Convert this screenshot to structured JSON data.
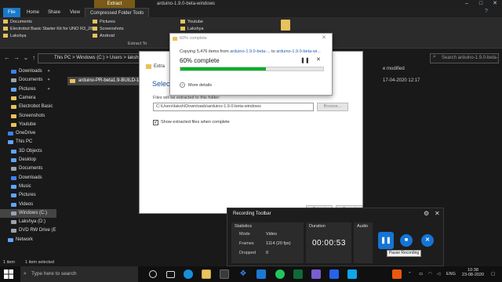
{
  "window": {
    "context_tab": "Extract",
    "title": "arduino-1.9.0-beta-windows"
  },
  "ribbon": {
    "tabs": [
      "File",
      "Home",
      "Share",
      "View",
      "Compressed Folder Tools"
    ],
    "quick_col1": [
      "Documents",
      "Electrobot Basic Starter Kit for UNO R3_28",
      "Lakshya"
    ],
    "quick_col2": [
      "Pictures",
      "Screenshots",
      "Android"
    ],
    "quick_col3": [
      "Youtube",
      "Lakshya"
    ],
    "group_label": "Extract To"
  },
  "address": {
    "crumbs": [
      "This PC",
      "Windows (C:)",
      "Users",
      "laksh"
    ],
    "search_placeholder": "Search arduino-1.9.0-beta-w..."
  },
  "nav": {
    "items": [
      {
        "label": "Downloads",
        "icon": "download-icon",
        "color": "#3b82f6",
        "pinned": true
      },
      {
        "label": "Documents",
        "icon": "document-icon",
        "color": "#9ca3af",
        "pinned": true
      },
      {
        "label": "Pictures",
        "icon": "picture-icon",
        "color": "#60a5fa",
        "pinned": true
      },
      {
        "label": "Camera",
        "icon": "folder-icon",
        "color": "#e8c25b",
        "pinned": false
      },
      {
        "label": "Electrobot Basic",
        "icon": "folder-icon",
        "color": "#e8c25b",
        "pinned": false
      },
      {
        "label": "Screenshots",
        "icon": "folder-icon",
        "color": "#e8c25b",
        "pinned": false
      },
      {
        "label": "Youtube",
        "icon": "folder-icon",
        "color": "#e8c25b",
        "pinned": false
      },
      {
        "label": "OneDrive",
        "icon": "cloud-icon",
        "color": "#3b82f6",
        "pinned": false
      },
      {
        "label": "This PC",
        "icon": "computer-icon",
        "color": "#60a5fa",
        "pinned": false
      },
      {
        "label": "3D Objects",
        "icon": "cube-icon",
        "color": "#60a5fa",
        "pinned": false
      },
      {
        "label": "Desktop",
        "icon": "desktop-icon",
        "color": "#60a5fa",
        "pinned": false
      },
      {
        "label": "Documents",
        "icon": "document-icon",
        "color": "#9ca3af",
        "pinned": false
      },
      {
        "label": "Downloads",
        "icon": "download-icon",
        "color": "#3b82f6",
        "pinned": false
      },
      {
        "label": "Music",
        "icon": "music-icon",
        "color": "#60a5fa",
        "pinned": false
      },
      {
        "label": "Pictures",
        "icon": "picture-icon",
        "color": "#60a5fa",
        "pinned": false
      },
      {
        "label": "Videos",
        "icon": "video-icon",
        "color": "#60a5fa",
        "pinned": false
      },
      {
        "label": "Windows (C:)",
        "icon": "drive-icon",
        "color": "#9ca3af",
        "pinned": false,
        "selected": true
      },
      {
        "label": "Lakshya (D:)",
        "icon": "drive-icon",
        "color": "#9ca3af",
        "pinned": false
      },
      {
        "label": "DVD RW Drive (E",
        "icon": "dvd-icon",
        "color": "#9ca3af",
        "pinned": false
      },
      {
        "label": "Network",
        "icon": "network-icon",
        "color": "#60a5fa",
        "pinned": false
      }
    ]
  },
  "files": {
    "item": "arduino-PR-beta1.9-BUILD-119",
    "date_header": "e modified",
    "date_value": "17-04-2020 12:17"
  },
  "statusbar": {
    "count": "1 item",
    "selected": "1 item selected"
  },
  "wizard": {
    "title": "Extra",
    "heading": "Select",
    "files_label": "Files will be extracted to this folder:",
    "path": "C:\\Users\\laksh\\Downloads\\arduino-1.9.0-beta-windows",
    "browse": "Browse...",
    "checkbox_label": "Show extracted files when complete",
    "checkbox_mark": "✓",
    "extract_btn": "Extract",
    "cancel_btn": "Cancel"
  },
  "progress": {
    "title": "60% complete",
    "copy_prefix": "Copying 5,476 items from",
    "from": "arduino-1.9.0-beta-...",
    "to_word": "to",
    "to": "arduino-1.9.0-beta-wi...",
    "percent_label": "60% complete",
    "fraction": 0.6,
    "more_details": "More details",
    "fill_color": "#06b025"
  },
  "recorder": {
    "title": "Recording Toolbar",
    "statistics_label": "Statistics",
    "duration_label": "Duration",
    "audio_label": "Audio",
    "rows": [
      {
        "key": "Mode",
        "value": "Video"
      },
      {
        "key": "Frames",
        "value": "1114 (20 fps)"
      },
      {
        "key": "Dropped",
        "value": "0"
      }
    ],
    "duration": "00:00:53",
    "tooltip": "Pause Recording",
    "accent": "#1574d4"
  },
  "taskbar": {
    "search_placeholder": "Type here to search",
    "time": "10:38",
    "date": "23-08-2020",
    "lang": "ENG"
  }
}
